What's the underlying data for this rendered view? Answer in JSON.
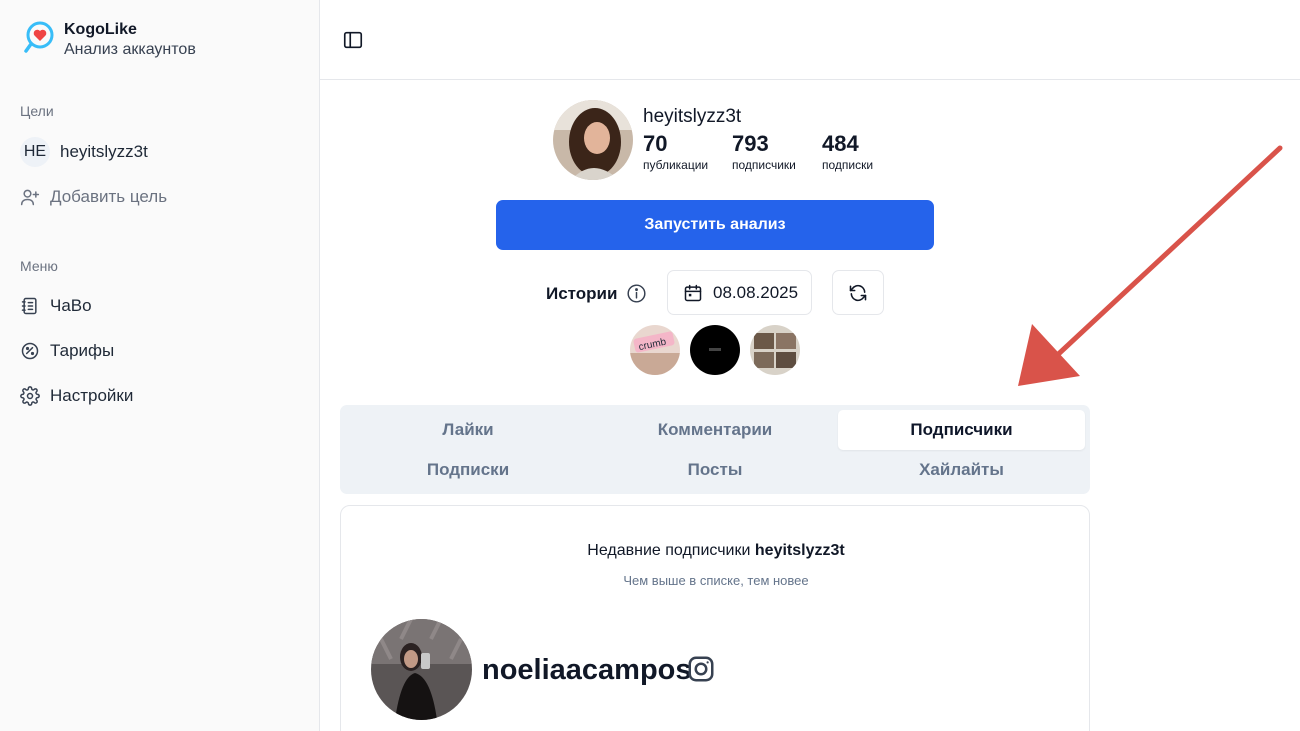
{
  "brand": {
    "name": "KogoLike",
    "subtitle": "Анализ аккаунтов"
  },
  "sidebar": {
    "targets_label": "Цели",
    "targets": [
      {
        "badge": "HE",
        "label": "heyitslyzz3t"
      }
    ],
    "add_target_label": "Добавить цель",
    "menu_label": "Меню",
    "menu_items": [
      {
        "icon": "faq-icon",
        "label": "ЧаВо"
      },
      {
        "icon": "pricing-icon",
        "label": "Тарифы"
      },
      {
        "icon": "settings-icon",
        "label": "Настройки"
      }
    ]
  },
  "profile": {
    "username": "heyitslyzz3t",
    "stats": [
      {
        "value": "70",
        "label": "публикации"
      },
      {
        "value": "793",
        "label": "подписчики"
      },
      {
        "value": "484",
        "label": "подписки"
      }
    ],
    "run_button_label": "Запустить анализ"
  },
  "stories": {
    "label": "Истории",
    "date": "08.08.2025",
    "thumb_text": "crumb"
  },
  "tabs": [
    {
      "label": "Лайки",
      "active": false
    },
    {
      "label": "Комментарии",
      "active": false
    },
    {
      "label": "Подписчики",
      "active": true
    },
    {
      "label": "Подписки",
      "active": false
    },
    {
      "label": "Посты",
      "active": false
    },
    {
      "label": "Хайлайты",
      "active": false
    }
  ],
  "followers_card": {
    "title_prefix": "Недавние подписчики",
    "title_user": "heyitslyzz3t",
    "subtitle": "Чем выше в списке, тем новее",
    "items": [
      {
        "username": "noeliaacampos"
      }
    ]
  },
  "colors": {
    "accent": "#2563eb",
    "arrow": "#d9534a"
  }
}
